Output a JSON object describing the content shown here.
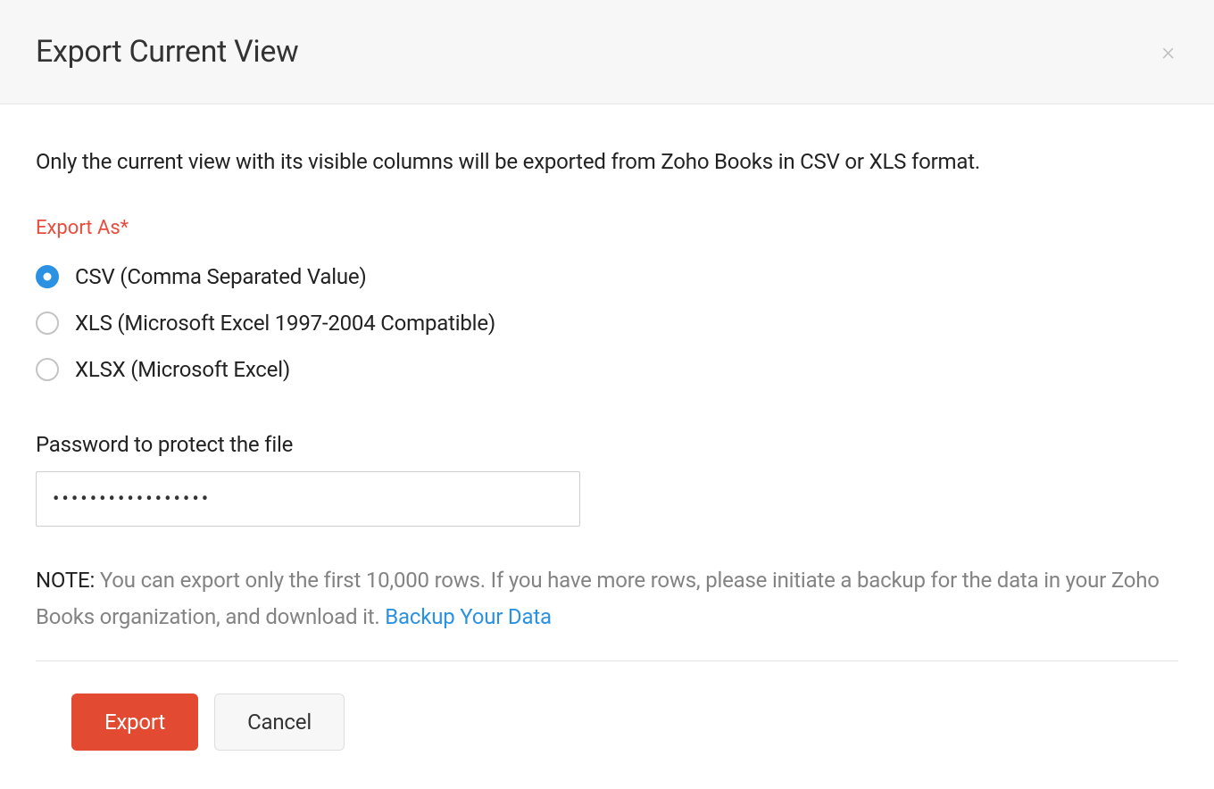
{
  "modal": {
    "title": "Export Current View",
    "description": "Only the current view with its visible columns will be exported from Zoho Books in CSV or XLS format.",
    "exportAsLabel": "Export As*",
    "options": [
      {
        "label": "CSV (Comma Separated Value)",
        "selected": true
      },
      {
        "label": "XLS (Microsoft Excel 1997-2004 Compatible)",
        "selected": false
      },
      {
        "label": "XLSX (Microsoft Excel)",
        "selected": false
      }
    ],
    "passwordLabel": "Password to protect the file",
    "passwordValue": "•••••••••••••••••",
    "note": {
      "prefix": "NOTE:",
      "text": "  You can export only the first 10,000 rows. If you have more rows, please initiate a backup for the data in your Zoho Books organization, and download it. ",
      "linkText": "Backup Your Data"
    },
    "buttons": {
      "export": "Export",
      "cancel": "Cancel"
    }
  }
}
